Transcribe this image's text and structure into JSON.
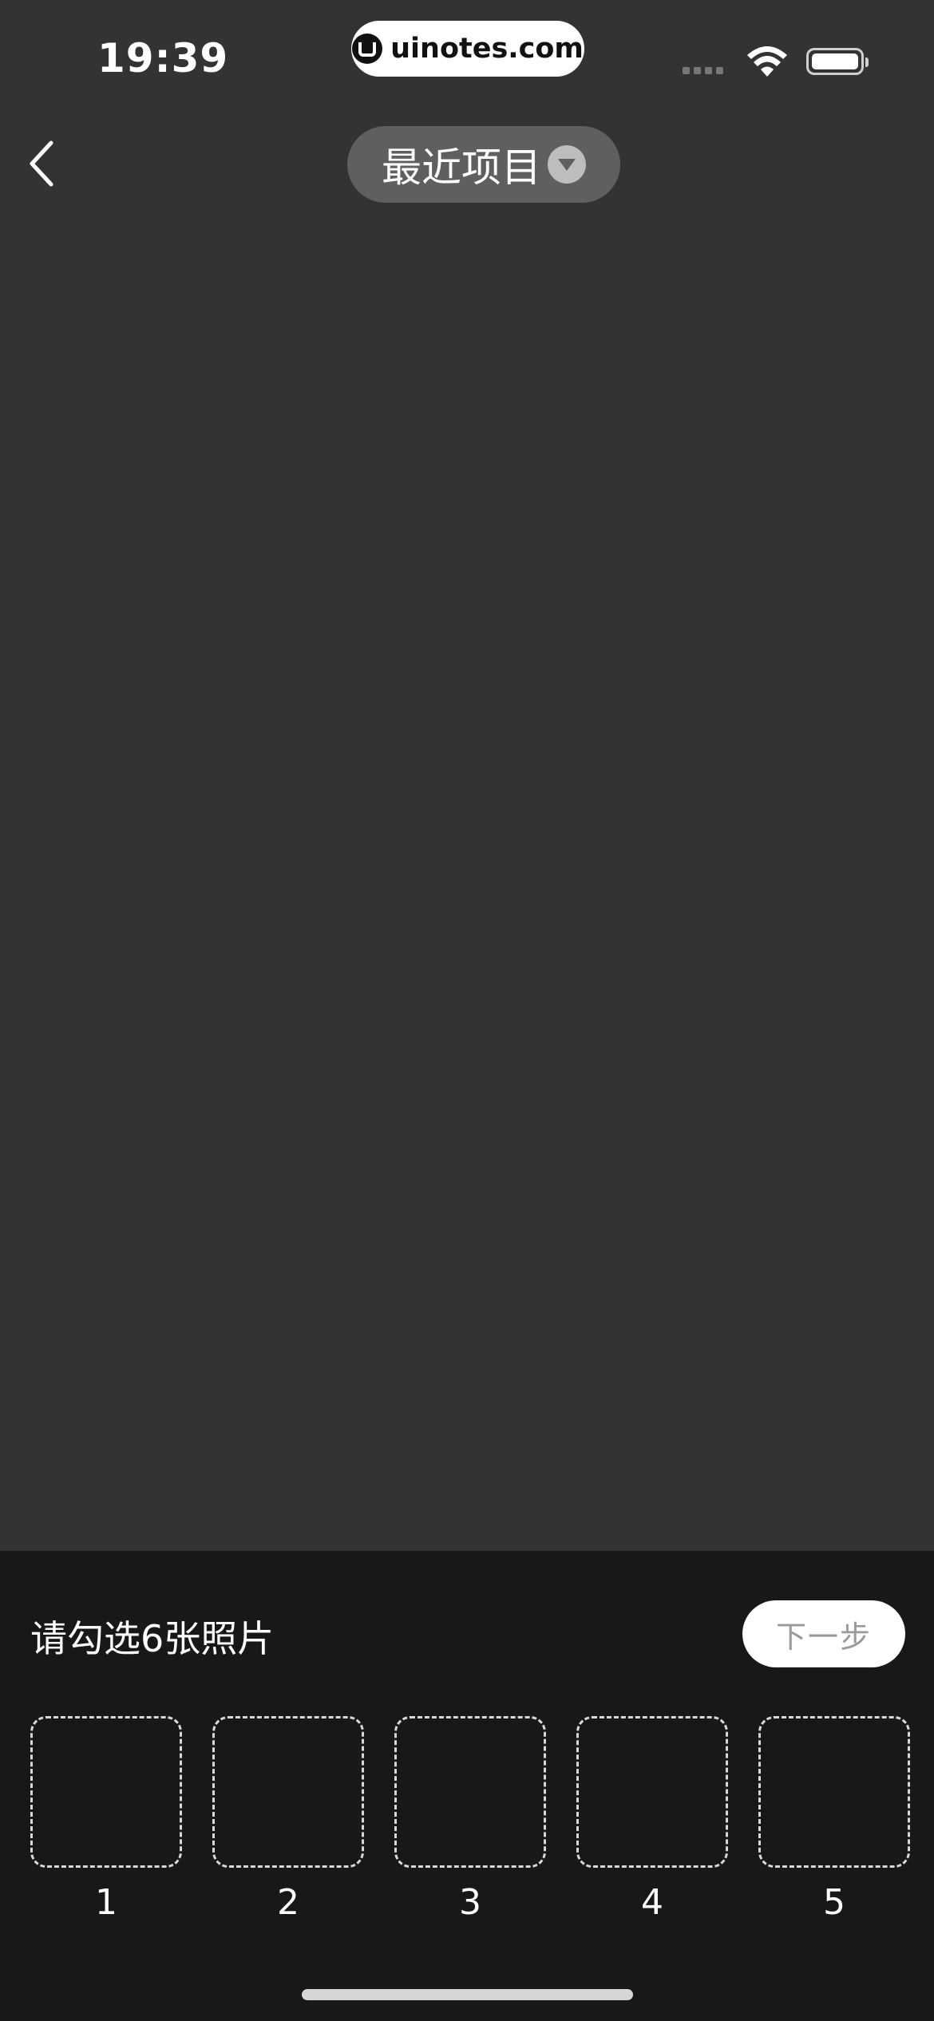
{
  "status_bar": {
    "time": "19:39",
    "url": "uinotes.com",
    "signal_icon": "cellular-signal-icon",
    "wifi_icon": "wifi-icon",
    "battery_icon": "battery-icon"
  },
  "header": {
    "back_icon": "chevron-left-icon",
    "album_label": "最近项目",
    "album_dropdown_icon": "triangle-down-icon"
  },
  "bottom_panel": {
    "prompt": "请勾选6张照片",
    "next_label": "下一步",
    "slots": [
      {
        "number": "1"
      },
      {
        "number": "2"
      },
      {
        "number": "3"
      },
      {
        "number": "4"
      },
      {
        "number": "5"
      }
    ]
  },
  "colors": {
    "background": "#333333",
    "panel": "#181818",
    "pill": "#5f5f5f"
  }
}
